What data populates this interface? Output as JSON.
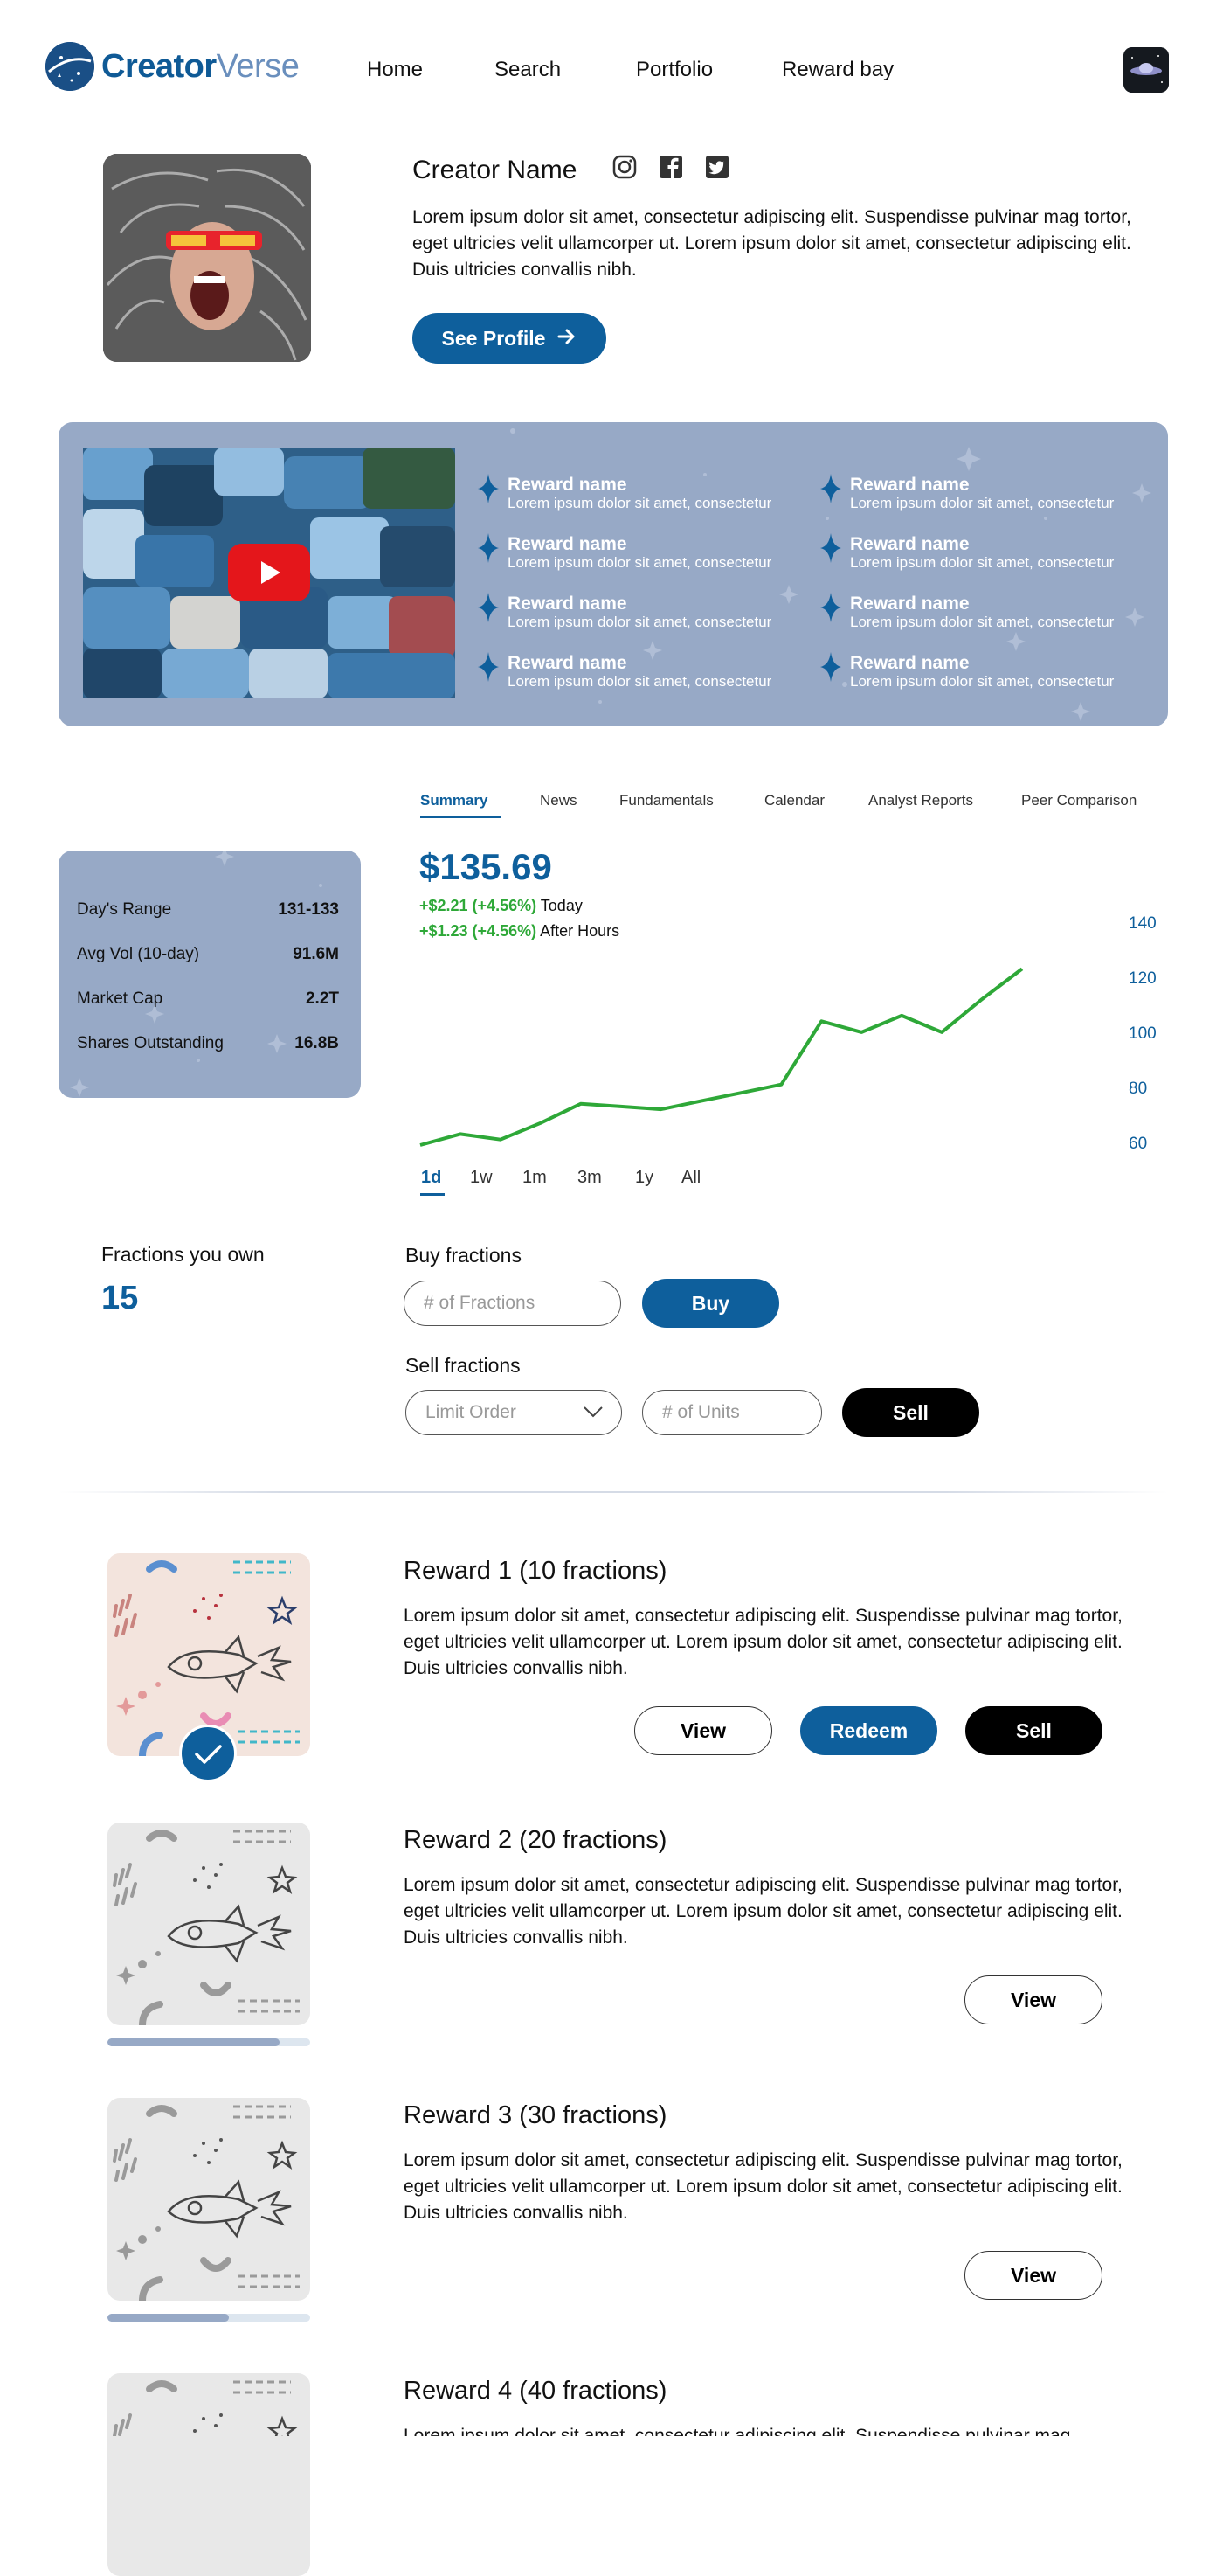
{
  "header": {
    "logo_part1": "Creator",
    "logo_part2": "Verse",
    "nav": [
      "Home",
      "Search",
      "Portfolio",
      "Reward bay"
    ]
  },
  "creator": {
    "name": "Creator Name",
    "description": "Lorem ipsum dolor sit amet, consectetur adipiscing elit. Suspendisse pulvinar mag tortor, eget ultricies velit ullamcorper ut. Lorem ipsum dolor sit amet, consectetur adipiscing elit. Duis ultricies convallis nibh.",
    "profile_button": "See Profile",
    "social_icons": [
      "instagram-icon",
      "facebook-icon",
      "twitter-icon"
    ]
  },
  "rewards_banner": {
    "items": [
      {
        "name": "Reward name",
        "desc": "Lorem ipsum dolor sit amet, consectetur"
      },
      {
        "name": "Reward name",
        "desc": "Lorem ipsum dolor sit amet, consectetur"
      },
      {
        "name": "Reward name",
        "desc": "Lorem ipsum dolor sit amet, consectetur"
      },
      {
        "name": "Reward name",
        "desc": "Lorem ipsum dolor sit amet, consectetur"
      },
      {
        "name": "Reward name",
        "desc": "Lorem ipsum dolor sit amet, consectetur"
      },
      {
        "name": "Reward name",
        "desc": "Lorem ipsum dolor sit amet, consectetur"
      },
      {
        "name": "Reward name",
        "desc": "Lorem ipsum dolor sit amet, consectetur"
      },
      {
        "name": "Reward name",
        "desc": "Lorem ipsum dolor sit amet, consectetur"
      }
    ]
  },
  "tabs": [
    "Summary",
    "News",
    "Fundamentals",
    "Calendar",
    "Analyst Reports",
    "Peer Comparison"
  ],
  "stats": [
    {
      "label": "Day's Range",
      "value": "131-133"
    },
    {
      "label": "Avg Vol (10-day)",
      "value": "91.6M"
    },
    {
      "label": "Market Cap",
      "value": "2.2T"
    },
    {
      "label": "Shares Outstanding",
      "value": "16.8B"
    }
  ],
  "quote": {
    "price": "$135.69",
    "change_today": "+$2.21 (+4.56%)",
    "today_label": "Today",
    "change_after": "+$1.23 (+4.56%)",
    "after_label": "After Hours"
  },
  "ranges": [
    "1d",
    "1w",
    "1m",
    "3m",
    "1y",
    "All"
  ],
  "chart_data": {
    "type": "line",
    "x": [
      0,
      1,
      2,
      3,
      4,
      5,
      6,
      7,
      8,
      9,
      10,
      11,
      12,
      13,
      14,
      15
    ],
    "values": [
      60,
      64,
      62,
      68,
      75,
      74,
      73,
      76,
      79,
      82,
      105,
      101,
      107,
      101,
      113,
      124
    ],
    "y_ticks": [
      140,
      120,
      100,
      80,
      60
    ],
    "ylim": [
      60,
      140
    ],
    "line_color": "#2ea838",
    "axis_position": "right",
    "grid": false
  },
  "holdings": {
    "label": "Fractions you own",
    "value": "15"
  },
  "buy": {
    "label": "Buy fractions",
    "placeholder": "# of Fractions",
    "button": "Buy"
  },
  "sell": {
    "label": "Sell fractions",
    "order_type": "Limit Order",
    "placeholder": "# of Units",
    "button": "Sell"
  },
  "reward_list": [
    {
      "title": "Reward 1 (10 fractions)",
      "desc": "Lorem ipsum dolor sit amet, consectetur adipiscing elit. Suspendisse pulvinar mag tortor, eget ultricies velit ullamcorper ut. Lorem ipsum dolor sit amet, consectetur adipiscing elit. Duis ultricies convallis nibh.",
      "view": "View",
      "redeem": "Redeem",
      "sell": "Sell",
      "owned": true
    },
    {
      "title": "Reward 2 (20 fractions)",
      "desc": "Lorem ipsum dolor sit amet, consectetur adipiscing elit. Suspendisse pulvinar mag tortor, eget ultricies velit ullamcorper ut. Lorem ipsum dolor sit amet, consectetur adipiscing elit. Duis ultricies convallis nibh.",
      "view": "View",
      "progress": 0.85
    },
    {
      "title": "Reward 3 (30 fractions)",
      "desc": "Lorem ipsum dolor sit amet, consectetur adipiscing elit. Suspendisse pulvinar mag tortor, eget ultricies velit ullamcorper ut. Lorem ipsum dolor sit amet, consectetur adipiscing elit. Duis ultricies convallis nibh.",
      "view": "View",
      "progress": 0.6
    },
    {
      "title": "Reward 4 (40 fractions)",
      "desc": "Lorem ipsum dolor sit amet, consectetur adipiscing elit. Suspendisse pulvinar mag"
    }
  ],
  "colors": {
    "brand": "#0e5f9c",
    "banner": "#97a9c6",
    "positive": "#2ea838"
  }
}
